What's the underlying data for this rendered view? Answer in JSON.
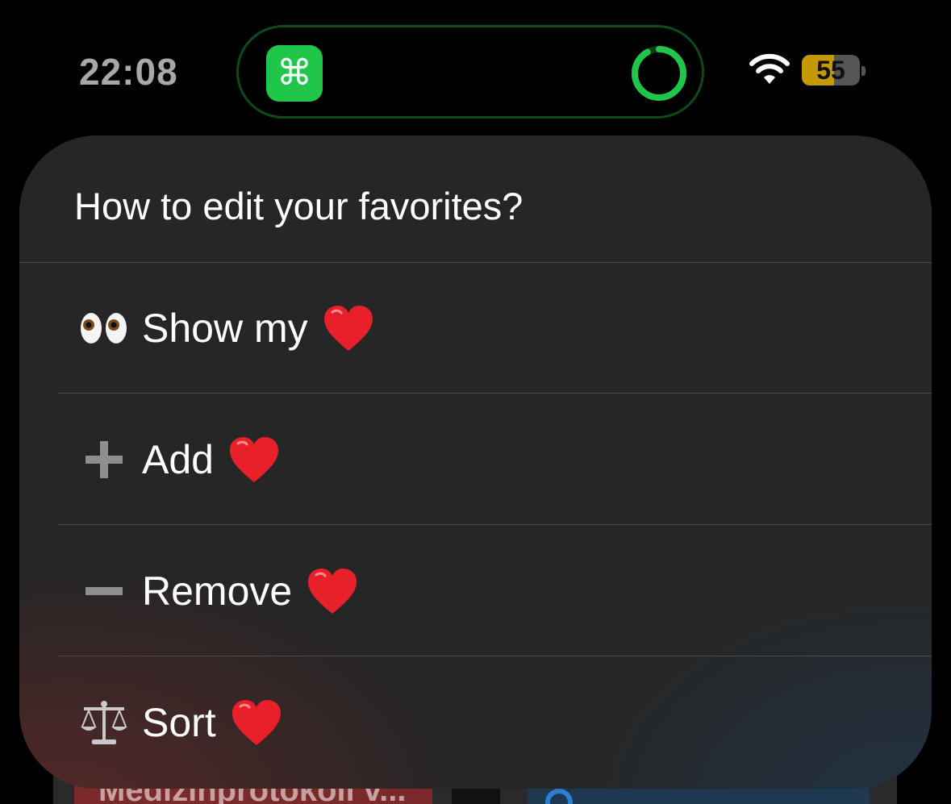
{
  "status_bar": {
    "time": "22:08",
    "battery_level": "55",
    "battery_fraction": 0.55,
    "shortcut_glyph": "⌘",
    "shortcut_color": "#1fc64a",
    "progress_fraction": 0.92,
    "progress_color": "#1fc64a"
  },
  "sheet": {
    "prompt": "How to edit your favorites?",
    "options": [
      {
        "icon": "eyes-icon",
        "label": "Show my"
      },
      {
        "icon": "plus-icon",
        "label": "Add"
      },
      {
        "icon": "minus-icon",
        "label": "Remove"
      },
      {
        "icon": "balance-scale-icon",
        "label": "Sort"
      }
    ],
    "heart_color": "#e8202a"
  },
  "background": {
    "peek_label": "Medizinprotokoll v..."
  }
}
